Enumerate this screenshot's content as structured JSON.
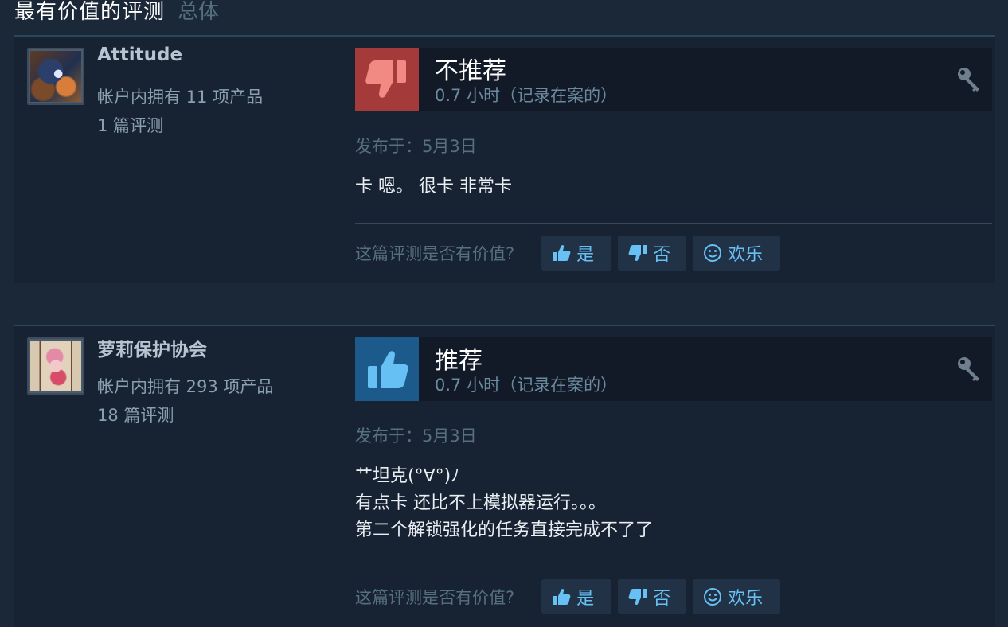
{
  "header": {
    "title": "最有价值的评测",
    "subtitle": "总体"
  },
  "reviews": [
    {
      "author": {
        "name": "Attitude",
        "products": "帐户内拥有 11 项产品",
        "reviews": "1 篇评测"
      },
      "verdict": "不推荐",
      "recommended": false,
      "hours": "0.7 小时（记录在案的）",
      "posted": "发布于：5月3日",
      "body": [
        "卡 嗯。 很卡 非常卡"
      ],
      "helpful": {
        "question": "这篇评测是否有价值?",
        "yes": "是",
        "no": "否",
        "funny": "欢乐"
      }
    },
    {
      "author": {
        "name": "萝莉保护协会",
        "products": "帐户内拥有 293 项产品",
        "reviews": "18 篇评测"
      },
      "verdict": "推荐",
      "recommended": true,
      "hours": "0.7 小时（记录在案的）",
      "posted": "发布于：5月3日",
      "body": [
        "艹坦克(°∀°)ﾉ",
        "有点卡 还比不上模拟器运行。。。",
        "第二个解锁强化的任务直接完成不了了"
      ],
      "helpful": {
        "question": "这篇评测是否有价值?",
        "yes": "是",
        "no": "否",
        "funny": "欢乐"
      }
    }
  ],
  "icons": {
    "thumb_down": "thumbs-down-icon",
    "thumb_up": "thumbs-up-icon",
    "key": "key-icon",
    "smile": "smile-icon"
  },
  "colors": {
    "background": "#1b2838",
    "negative": "#a53a3a",
    "positive": "#1d5a8c",
    "link": "#67c1f5"
  }
}
